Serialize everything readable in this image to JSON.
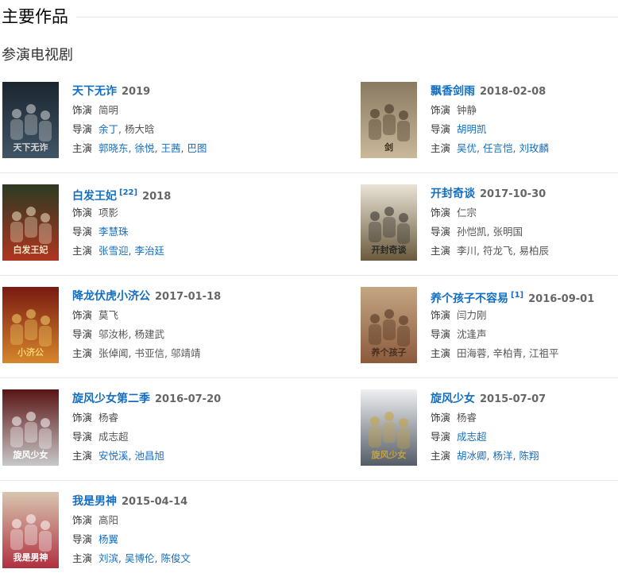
{
  "section": {
    "title": "主要作品",
    "subtitle": "参演电视剧"
  },
  "labels": {
    "role": "饰演",
    "director": "导演",
    "cast": "主演"
  },
  "colors": {
    "link": "#136ec2",
    "year": "#666666",
    "text": "#333333",
    "divider": "#e8e8e8"
  },
  "works": [
    {
      "title": "天下无诈",
      "ref": "",
      "year": "2019",
      "role": "简明",
      "directors": [
        {
          "name": "余丁",
          "link": true
        },
        {
          "name": "杨大晗",
          "link": false
        }
      ],
      "cast": [
        {
          "name": "郭晓东",
          "link": true
        },
        {
          "name": "徐悦",
          "link": true
        },
        {
          "name": "王茜",
          "link": true
        },
        {
          "name": "巴图",
          "link": true
        }
      ],
      "poster_caption": "天下无诈"
    },
    {
      "title": "飘香剑雨",
      "ref": "",
      "year": "2018-02-08",
      "role": "钟静",
      "directors": [
        {
          "name": "胡明凯",
          "link": true
        }
      ],
      "cast": [
        {
          "name": "吴优",
          "link": true
        },
        {
          "name": "任言恺",
          "link": true
        },
        {
          "name": "刘玫麟",
          "link": true
        }
      ],
      "poster_caption": "剑"
    },
    {
      "title": "白发王妃",
      "ref": "[22]",
      "year": "2018",
      "role": "项影",
      "directors": [
        {
          "name": "李慧珠",
          "link": true
        }
      ],
      "cast": [
        {
          "name": "张雪迎",
          "link": true
        },
        {
          "name": "李治廷",
          "link": true
        }
      ],
      "poster_caption": "白发王妃"
    },
    {
      "title": "开封奇谈",
      "ref": "",
      "year": "2017-10-30",
      "role": "仁宗",
      "directors": [
        {
          "name": "孙恺凯",
          "link": false
        },
        {
          "name": "张明国",
          "link": false
        }
      ],
      "cast": [
        {
          "name": "李川",
          "link": false
        },
        {
          "name": "符龙飞",
          "link": false
        },
        {
          "name": "易柏辰",
          "link": false
        }
      ],
      "poster_caption": "开封奇谈"
    },
    {
      "title": "降龙伏虎小济公",
      "ref": "",
      "year": "2017-01-18",
      "role": "莫飞",
      "directors": [
        {
          "name": "邬汝彬",
          "link": false
        },
        {
          "name": "杨建武",
          "link": false
        }
      ],
      "cast": [
        {
          "name": "张倬闻",
          "link": false
        },
        {
          "name": "书亚信",
          "link": false
        },
        {
          "name": "邬靖靖",
          "link": false
        }
      ],
      "poster_caption": "小济公"
    },
    {
      "title": "养个孩子不容易",
      "ref": "[1]",
      "year": "2016-09-01",
      "role": "闫力刚",
      "directors": [
        {
          "name": "沈逢声",
          "link": false
        }
      ],
      "cast": [
        {
          "name": "田海蓉",
          "link": false
        },
        {
          "name": "辛柏青",
          "link": false
        },
        {
          "name": "江祖平",
          "link": false
        }
      ],
      "poster_caption": "养个孩子"
    },
    {
      "title": "旋风少女第二季",
      "ref": "",
      "year": "2016-07-20",
      "role": "杨睿",
      "directors": [
        {
          "name": "成志超",
          "link": false
        }
      ],
      "cast": [
        {
          "name": "安悦溪",
          "link": true
        },
        {
          "name": "池昌旭",
          "link": true
        }
      ],
      "poster_caption": "旋风少女"
    },
    {
      "title": "旋风少女",
      "ref": "",
      "year": "2015-07-07",
      "role": "杨睿",
      "directors": [
        {
          "name": "成志超",
          "link": true
        }
      ],
      "cast": [
        {
          "name": "胡冰卿",
          "link": true
        },
        {
          "name": "杨洋",
          "link": true
        },
        {
          "name": "陈翔",
          "link": true
        }
      ],
      "poster_caption": "旋风少女"
    },
    {
      "title": "我是男神",
      "ref": "",
      "year": "2015-04-14",
      "role": "高阳",
      "directors": [
        {
          "name": "杨翼",
          "link": true
        }
      ],
      "cast": [
        {
          "name": "刘滨",
          "link": true
        },
        {
          "name": "吴博伦",
          "link": true
        },
        {
          "name": "陈俊文",
          "link": true
        }
      ],
      "poster_caption": "我是男神"
    }
  ]
}
